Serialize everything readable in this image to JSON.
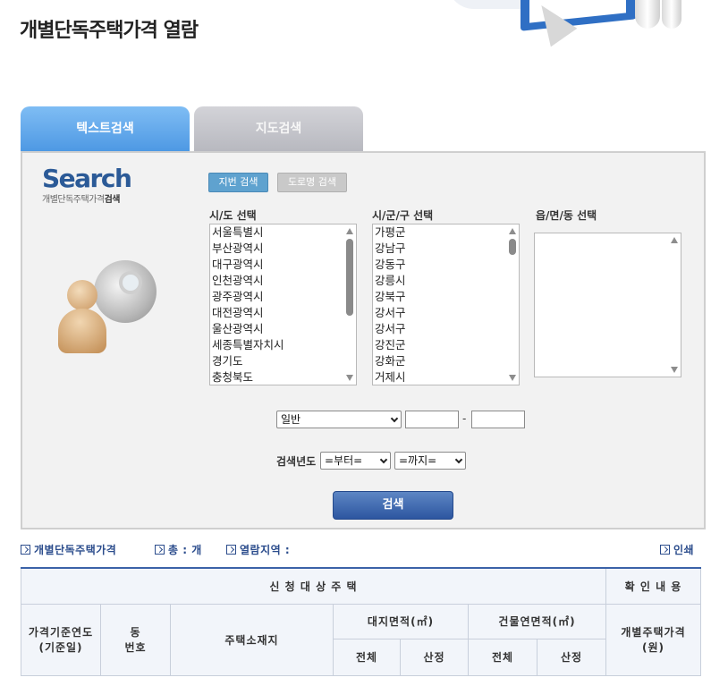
{
  "page_title": "개별단독주택가격 열람",
  "tabs": [
    {
      "label": "텍스트검색",
      "active": true
    },
    {
      "label": "지도검색",
      "active": false
    }
  ],
  "logo": {
    "word": "Search",
    "sub_normal": "개별단독주택가격",
    "sub_bold": "검색"
  },
  "search_type": {
    "jibun_label": "지번 검색",
    "road_label": "도로명 검색",
    "selected": "지번 검색"
  },
  "sido": {
    "label": "시/도 선택",
    "items": [
      "서울특별시",
      "부산광역시",
      "대구광역시",
      "인천광역시",
      "광주광역시",
      "대전광역시",
      "울산광역시",
      "세종특별자치시",
      "경기도",
      "충청북도"
    ]
  },
  "sigungu": {
    "label": "시/군/구 선택",
    "items": [
      "가평군",
      "강남구",
      "강동구",
      "강릉시",
      "강북구",
      "강서구",
      "강서구",
      "강진군",
      "강화군",
      "거제시"
    ]
  },
  "emd": {
    "label": "읍/면/동 선택",
    "items": []
  },
  "lot": {
    "type_value": "일반",
    "dash": "-",
    "main_no": "",
    "sub_no": ""
  },
  "year": {
    "label": "검색년도",
    "from_value": "=부터=",
    "to_value": "=까지="
  },
  "search_button": "검색",
  "info": {
    "house_label": "개별단독주택가격",
    "total_label": "총 : 개",
    "region_label": "열람지역 :",
    "print_label": "인쇄"
  },
  "table": {
    "group_target": "신 청 대 상 주 택",
    "group_confirm": "확 인 내 용",
    "col_base_year": "가격기준연도",
    "col_base_date": "(기준일)",
    "col_dong": "동",
    "col_number": "번호",
    "col_address": "주택소재지",
    "col_land_area": "대지면적(㎡)",
    "col_bldg_area": "건물연면적(㎡)",
    "col_price": "개별주택가격",
    "col_price_unit": "(원)",
    "sub_total": "전체",
    "sub_calc": "산정"
  },
  "colors": {
    "tab_active": "#5aa2e8",
    "tab_inactive": "#c0c1c8",
    "accent": "#2d56a0",
    "info_text": "#2b4c8c"
  }
}
